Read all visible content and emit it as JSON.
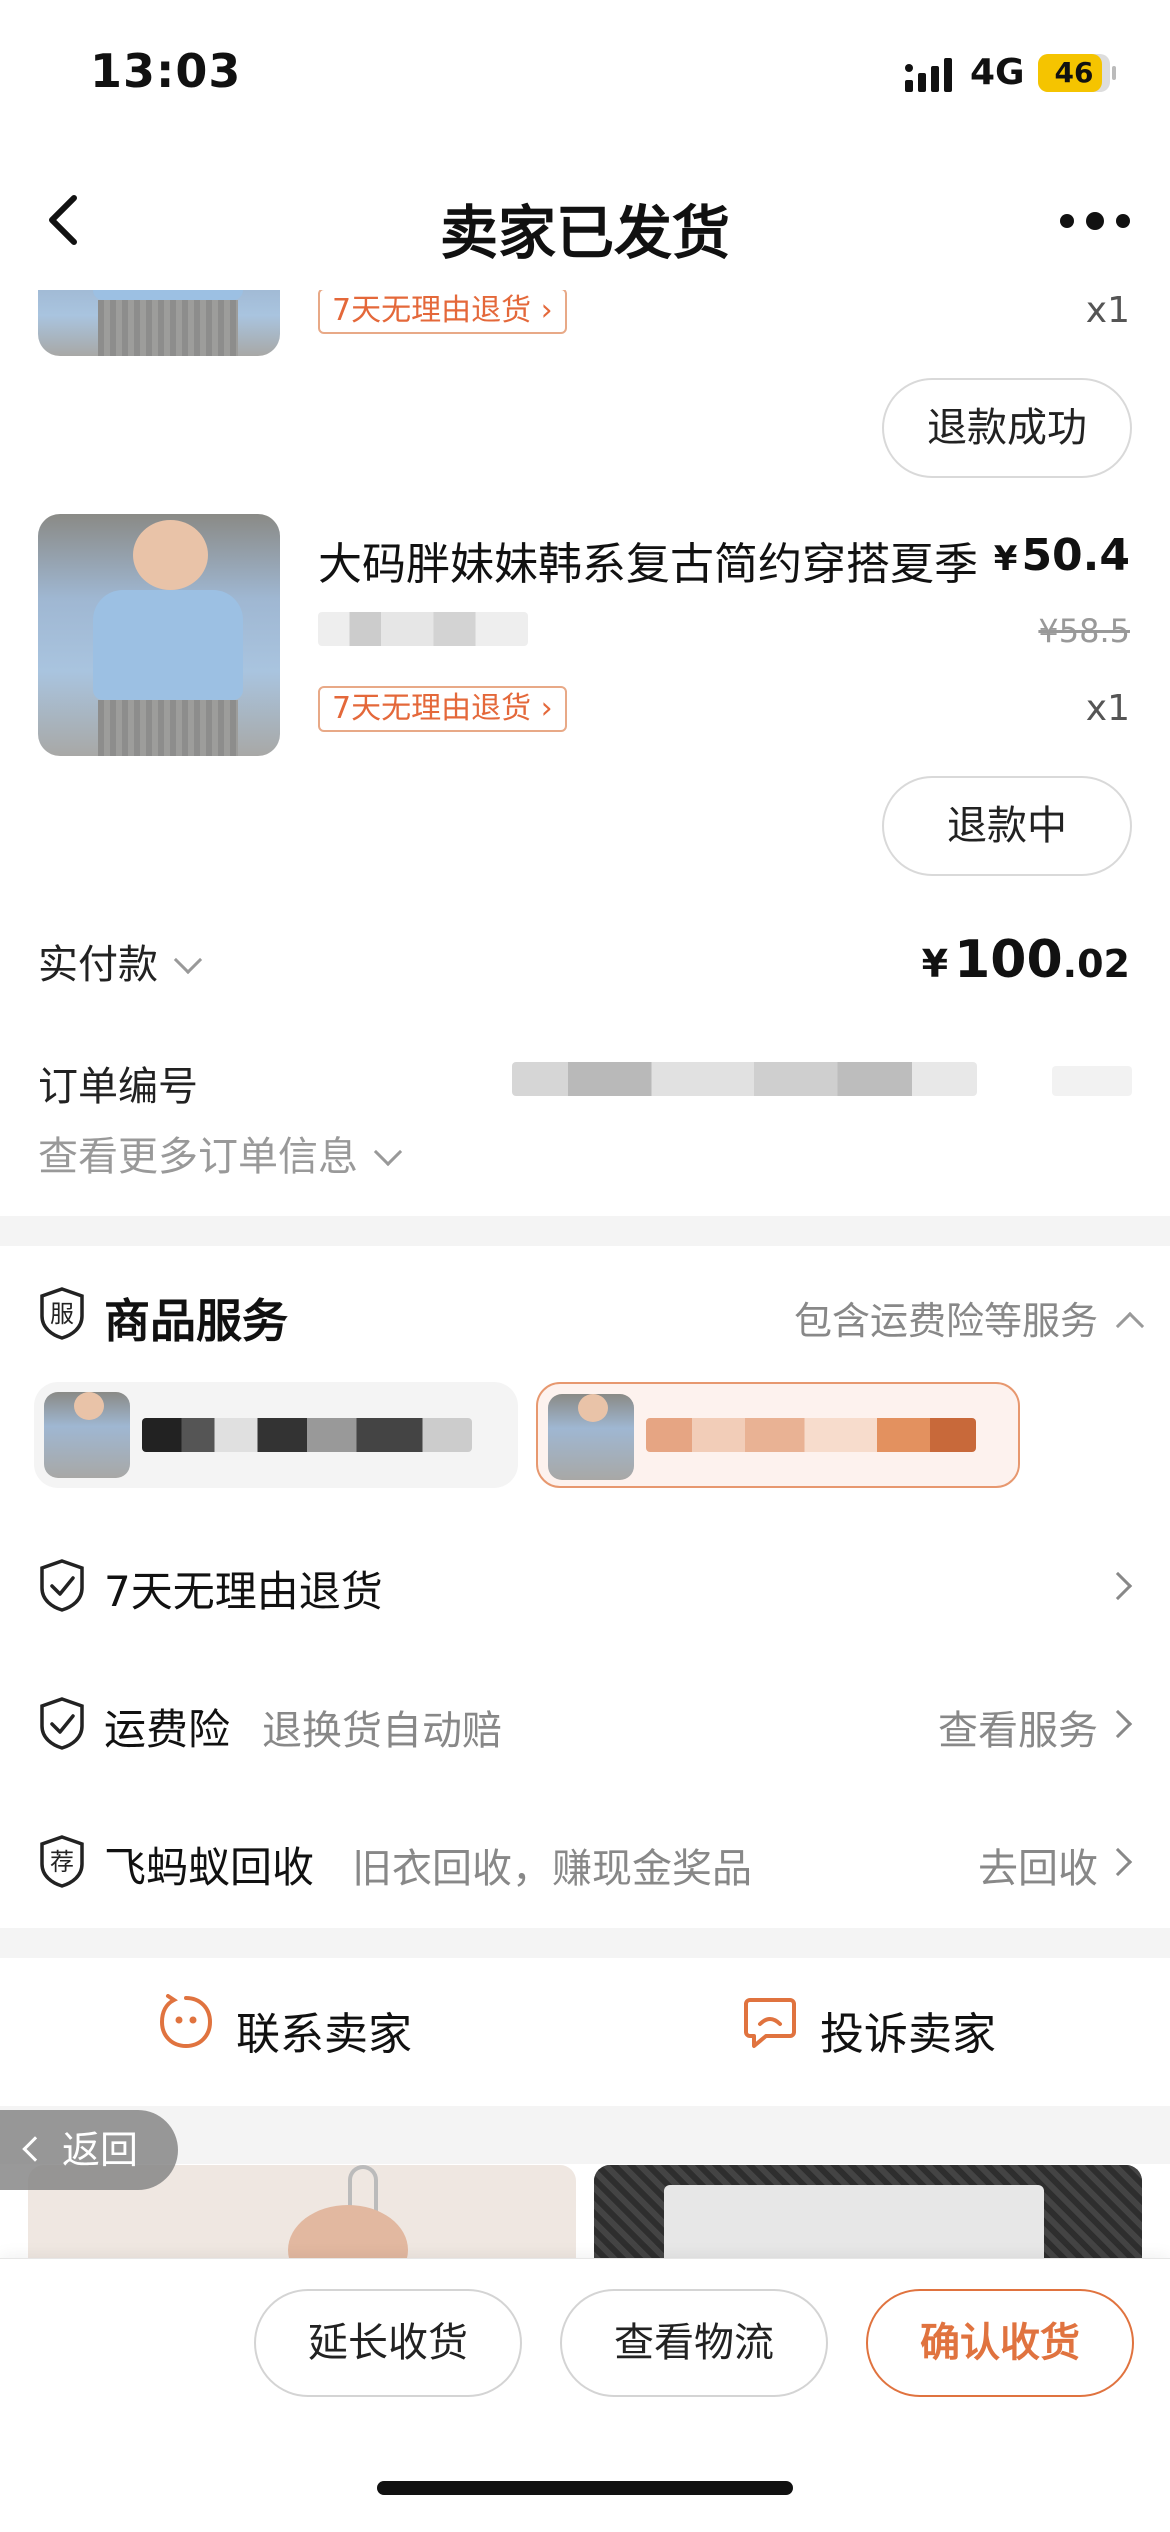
{
  "status_bar": {
    "time": "13:03",
    "network": "4G",
    "battery": "46",
    "battery_color": "#f5c400"
  },
  "nav": {
    "back_icon": "chevron-left-icon",
    "title": "卖家已发货",
    "more_icon": "more-dots-icon"
  },
  "items": [
    {
      "tag": "7天无理由退货",
      "qty": "x1",
      "status_button": "退款成功"
    },
    {
      "name": "大码胖妹妹韩系复古简约穿搭夏季",
      "price_symbol": "¥",
      "price": "50.4",
      "old_price": "¥58.5",
      "tag": "7天无理由退货",
      "qty": "x1",
      "status_button": "退款中"
    }
  ],
  "payment": {
    "label": "实付款",
    "symbol": "¥",
    "amount_int": "100",
    "amount_dec": ".02"
  },
  "order": {
    "number_label": "订单编号",
    "more_info": "查看更多订单信息"
  },
  "services": {
    "badge": "服",
    "title": "商品服务",
    "summary": "包含运费险等服务",
    "rows": [
      {
        "name": "7天无理由退货",
        "desc": "",
        "action": ""
      },
      {
        "name": "运费险",
        "desc": "退换货自动赔",
        "action": "查看服务"
      },
      {
        "name": "飞蚂蚁回收",
        "desc": "旧衣回收，赚现金奖品",
        "action": "去回收",
        "badge": "荐"
      }
    ]
  },
  "contact": {
    "seller": "联系卖家",
    "complain": "投诉卖家"
  },
  "float_back": "返回",
  "bottom_bar": {
    "extend": "延长收货",
    "logistics": "查看物流",
    "confirm": "确认收货"
  },
  "colors": {
    "accent": "#e0733f",
    "tag_text": "#e4683a",
    "muted": "#888888"
  }
}
